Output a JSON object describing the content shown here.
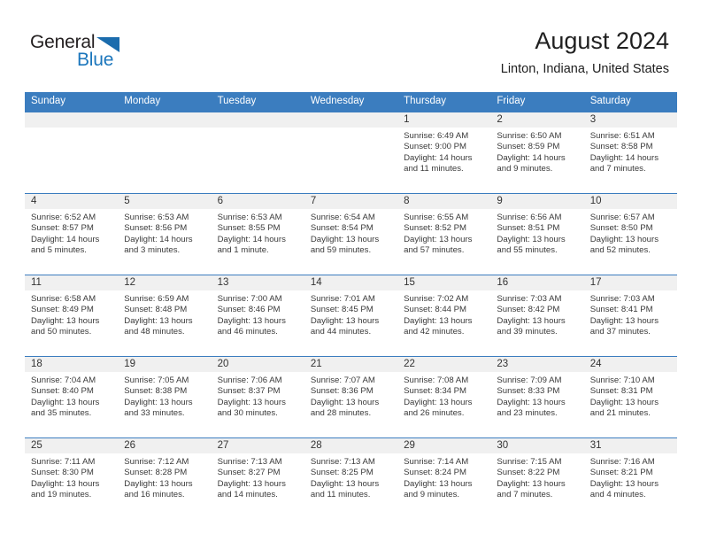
{
  "logo": {
    "word1": "General",
    "word2": "Blue",
    "triangle_color": "#1b6cad",
    "blue_color": "#1b76bc"
  },
  "header": {
    "title": "August 2024",
    "subtitle": "Linton, Indiana, United States"
  },
  "theme": {
    "header_bar": "#3b7dbf",
    "daynum_band": "#f0f0f0",
    "cell_bg": "#ffffff",
    "text": "#3a3a3a"
  },
  "columns": [
    "Sunday",
    "Monday",
    "Tuesday",
    "Wednesday",
    "Thursday",
    "Friday",
    "Saturday"
  ],
  "weeks": [
    [
      {
        "day": "",
        "sunrise": "",
        "sunset": "",
        "daylight": ""
      },
      {
        "day": "",
        "sunrise": "",
        "sunset": "",
        "daylight": ""
      },
      {
        "day": "",
        "sunrise": "",
        "sunset": "",
        "daylight": ""
      },
      {
        "day": "",
        "sunrise": "",
        "sunset": "",
        "daylight": ""
      },
      {
        "day": "1",
        "sunrise": "Sunrise: 6:49 AM",
        "sunset": "Sunset: 9:00 PM",
        "daylight": "Daylight: 14 hours and 11 minutes."
      },
      {
        "day": "2",
        "sunrise": "Sunrise: 6:50 AM",
        "sunset": "Sunset: 8:59 PM",
        "daylight": "Daylight: 14 hours and 9 minutes."
      },
      {
        "day": "3",
        "sunrise": "Sunrise: 6:51 AM",
        "sunset": "Sunset: 8:58 PM",
        "daylight": "Daylight: 14 hours and 7 minutes."
      }
    ],
    [
      {
        "day": "4",
        "sunrise": "Sunrise: 6:52 AM",
        "sunset": "Sunset: 8:57 PM",
        "daylight": "Daylight: 14 hours and 5 minutes."
      },
      {
        "day": "5",
        "sunrise": "Sunrise: 6:53 AM",
        "sunset": "Sunset: 8:56 PM",
        "daylight": "Daylight: 14 hours and 3 minutes."
      },
      {
        "day": "6",
        "sunrise": "Sunrise: 6:53 AM",
        "sunset": "Sunset: 8:55 PM",
        "daylight": "Daylight: 14 hours and 1 minute."
      },
      {
        "day": "7",
        "sunrise": "Sunrise: 6:54 AM",
        "sunset": "Sunset: 8:54 PM",
        "daylight": "Daylight: 13 hours and 59 minutes."
      },
      {
        "day": "8",
        "sunrise": "Sunrise: 6:55 AM",
        "sunset": "Sunset: 8:52 PM",
        "daylight": "Daylight: 13 hours and 57 minutes."
      },
      {
        "day": "9",
        "sunrise": "Sunrise: 6:56 AM",
        "sunset": "Sunset: 8:51 PM",
        "daylight": "Daylight: 13 hours and 55 minutes."
      },
      {
        "day": "10",
        "sunrise": "Sunrise: 6:57 AM",
        "sunset": "Sunset: 8:50 PM",
        "daylight": "Daylight: 13 hours and 52 minutes."
      }
    ],
    [
      {
        "day": "11",
        "sunrise": "Sunrise: 6:58 AM",
        "sunset": "Sunset: 8:49 PM",
        "daylight": "Daylight: 13 hours and 50 minutes."
      },
      {
        "day": "12",
        "sunrise": "Sunrise: 6:59 AM",
        "sunset": "Sunset: 8:48 PM",
        "daylight": "Daylight: 13 hours and 48 minutes."
      },
      {
        "day": "13",
        "sunrise": "Sunrise: 7:00 AM",
        "sunset": "Sunset: 8:46 PM",
        "daylight": "Daylight: 13 hours and 46 minutes."
      },
      {
        "day": "14",
        "sunrise": "Sunrise: 7:01 AM",
        "sunset": "Sunset: 8:45 PM",
        "daylight": "Daylight: 13 hours and 44 minutes."
      },
      {
        "day": "15",
        "sunrise": "Sunrise: 7:02 AM",
        "sunset": "Sunset: 8:44 PM",
        "daylight": "Daylight: 13 hours and 42 minutes."
      },
      {
        "day": "16",
        "sunrise": "Sunrise: 7:03 AM",
        "sunset": "Sunset: 8:42 PM",
        "daylight": "Daylight: 13 hours and 39 minutes."
      },
      {
        "day": "17",
        "sunrise": "Sunrise: 7:03 AM",
        "sunset": "Sunset: 8:41 PM",
        "daylight": "Daylight: 13 hours and 37 minutes."
      }
    ],
    [
      {
        "day": "18",
        "sunrise": "Sunrise: 7:04 AM",
        "sunset": "Sunset: 8:40 PM",
        "daylight": "Daylight: 13 hours and 35 minutes."
      },
      {
        "day": "19",
        "sunrise": "Sunrise: 7:05 AM",
        "sunset": "Sunset: 8:38 PM",
        "daylight": "Daylight: 13 hours and 33 minutes."
      },
      {
        "day": "20",
        "sunrise": "Sunrise: 7:06 AM",
        "sunset": "Sunset: 8:37 PM",
        "daylight": "Daylight: 13 hours and 30 minutes."
      },
      {
        "day": "21",
        "sunrise": "Sunrise: 7:07 AM",
        "sunset": "Sunset: 8:36 PM",
        "daylight": "Daylight: 13 hours and 28 minutes."
      },
      {
        "day": "22",
        "sunrise": "Sunrise: 7:08 AM",
        "sunset": "Sunset: 8:34 PM",
        "daylight": "Daylight: 13 hours and 26 minutes."
      },
      {
        "day": "23",
        "sunrise": "Sunrise: 7:09 AM",
        "sunset": "Sunset: 8:33 PM",
        "daylight": "Daylight: 13 hours and 23 minutes."
      },
      {
        "day": "24",
        "sunrise": "Sunrise: 7:10 AM",
        "sunset": "Sunset: 8:31 PM",
        "daylight": "Daylight: 13 hours and 21 minutes."
      }
    ],
    [
      {
        "day": "25",
        "sunrise": "Sunrise: 7:11 AM",
        "sunset": "Sunset: 8:30 PM",
        "daylight": "Daylight: 13 hours and 19 minutes."
      },
      {
        "day": "26",
        "sunrise": "Sunrise: 7:12 AM",
        "sunset": "Sunset: 8:28 PM",
        "daylight": "Daylight: 13 hours and 16 minutes."
      },
      {
        "day": "27",
        "sunrise": "Sunrise: 7:13 AM",
        "sunset": "Sunset: 8:27 PM",
        "daylight": "Daylight: 13 hours and 14 minutes."
      },
      {
        "day": "28",
        "sunrise": "Sunrise: 7:13 AM",
        "sunset": "Sunset: 8:25 PM",
        "daylight": "Daylight: 13 hours and 11 minutes."
      },
      {
        "day": "29",
        "sunrise": "Sunrise: 7:14 AM",
        "sunset": "Sunset: 8:24 PM",
        "daylight": "Daylight: 13 hours and 9 minutes."
      },
      {
        "day": "30",
        "sunrise": "Sunrise: 7:15 AM",
        "sunset": "Sunset: 8:22 PM",
        "daylight": "Daylight: 13 hours and 7 minutes."
      },
      {
        "day": "31",
        "sunrise": "Sunrise: 7:16 AM",
        "sunset": "Sunset: 8:21 PM",
        "daylight": "Daylight: 13 hours and 4 minutes."
      }
    ]
  ]
}
